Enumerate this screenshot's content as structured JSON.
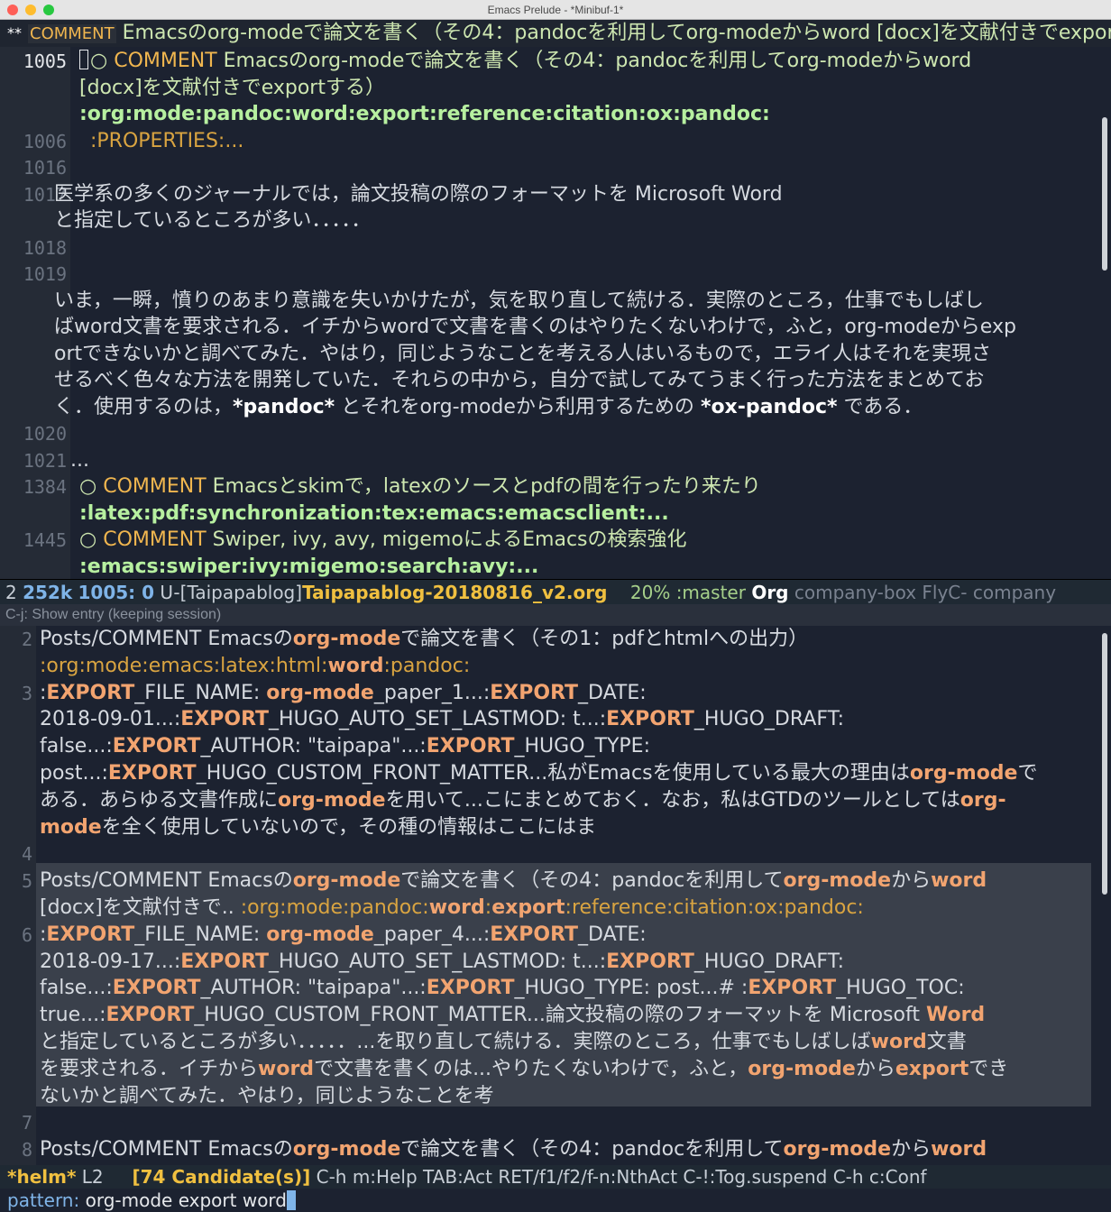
{
  "window": {
    "title": "Emacs Prelude -  *Minibuf-1*"
  },
  "header_line": {
    "stars": "**",
    "keyword": "COMMENT",
    "text": "Emacsのorg-modeで論文を書く（その4：pandocを利用してorg-modeからword [docx]を文献付きでexportする）"
  },
  "editor": {
    "lines": [
      {
        "num": "1005",
        "prefix": "○ ",
        "keyword": "COMMENT",
        "text": " Emacsのorg-modeで論文を書く（その4：pandocを利用してorg-modeからword"
      },
      {
        "num": "",
        "text": "[docx]を文献付きでexportする）"
      },
      {
        "num": "",
        "tags": ":org:mode:pandoc:word:export:reference:citation:ox:pandoc:"
      },
      {
        "num": "1006",
        "props": ":PROPERTIES:..."
      },
      {
        "num": "1016",
        "text": ""
      },
      {
        "num": "1017",
        "text": "  医学系の多くのジャーナルでは，論文投稿の際のフォーマットを Microsoft Word"
      },
      {
        "num": "",
        "text": "と指定しているところが多い．．．．．"
      },
      {
        "num": "1018",
        "text": ""
      },
      {
        "num": "1019",
        "text": ""
      },
      {
        "num": "",
        "text": "いま，一瞬，憤りのあまり意識を失いかけたが，気を取り直して続ける．実際のところ，仕事でもしばし"
      },
      {
        "num": "",
        "text": "ばword文書を要求される．イチからwordで文書を書くのはやりたくないわけで，ふと，org-modeからexp"
      },
      {
        "num": "",
        "text": "ortできないかと調べてみた．やはり，同じようなことを考える人はいるもので，エライ人はそれを実現さ"
      },
      {
        "num": "",
        "text": "せるべく色々な方法を開発していた．それらの中から，自分で試してみてうまく行った方法をまとめてお"
      },
      {
        "num": "",
        "text_a": "く．使用するのは，",
        "bold_a": "*pandoc*",
        "text_b": " とそれをorg-modeから利用するための ",
        "bold_b": "*ox-pandoc*",
        "text_c": " である．"
      },
      {
        "num": "1020",
        "text": ""
      },
      {
        "num": "1021",
        "text": "..."
      },
      {
        "num": "1384",
        "prefix": "○ ",
        "keyword": "COMMENT",
        "text": " Emacsとskimで，latexのソースとpdfの間を行ったり来たり"
      },
      {
        "num": "",
        "tags": ":latex:pdf:synchronization:tex:emacs:emacsclient:..."
      },
      {
        "num": "1445",
        "prefix": "○ ",
        "keyword": "COMMENT",
        "text": " Swiper, ivy, avy, migemoによるEmacsの検索強化"
      },
      {
        "num": "",
        "tags": ":emacs:swiper:ivy:migemo:search:avy:..."
      }
    ]
  },
  "modeline": {
    "window_num": "2",
    "size": "252k",
    "position": "1005: 0",
    "encoding": "U",
    "buffer_prefix": "-[Taipapablog]",
    "buffer_name": "Taipapablog-20180816_v2.org",
    "percent": "20%",
    "branch": ":master",
    "major_mode": "Org",
    "minor_modes": "company-box FlyC- company"
  },
  "helm": {
    "header": "C-j: Show entry (keeping session)",
    "candidates_text": [
      {
        "num": "2",
        "segs": [
          [
            "Posts/COMMENT Emacsの",
            ""
          ],
          [
            "org-mode",
            "m"
          ],
          [
            "で論文を書く（その1：pdfとhtmlへの出力）",
            ""
          ]
        ]
      },
      {
        "num": "",
        "segs": [
          [
            ":org:mode:emacs:latex:html:",
            "mtag"
          ],
          [
            "word",
            "m"
          ],
          [
            ":pandoc:",
            "mtag"
          ]
        ]
      },
      {
        "num": "3",
        "segs": [
          [
            ":",
            ""
          ],
          [
            "EXPORT",
            "m"
          ],
          [
            "_FILE_NAME: ",
            ""
          ],
          [
            "org-mode",
            "m"
          ],
          [
            "_paper_1...:",
            ""
          ],
          [
            "EXPORT",
            "m"
          ],
          [
            "_DATE:",
            ""
          ]
        ]
      },
      {
        "num": "",
        "segs": [
          [
            "2018-09-01...:",
            ""
          ],
          [
            "EXPORT",
            "m"
          ],
          [
            "_HUGO_AUTO_SET_LASTMOD: t...:",
            ""
          ],
          [
            "EXPORT",
            "m"
          ],
          [
            "_HUGO_DRAFT:",
            ""
          ]
        ]
      },
      {
        "num": "",
        "segs": [
          [
            "false...:",
            ""
          ],
          [
            "EXPORT",
            "m"
          ],
          [
            "_AUTHOR: \"taipapa\"...:",
            ""
          ],
          [
            "EXPORT",
            "m"
          ],
          [
            "_HUGO_TYPE:",
            ""
          ]
        ]
      },
      {
        "num": "",
        "segs": [
          [
            "post...:",
            ""
          ],
          [
            "EXPORT",
            "m"
          ],
          [
            "_HUGO_CUSTOM_FRONT_MATTER...私がEmacsを使用している最大の理由は",
            ""
          ],
          [
            "org-mode",
            "m"
          ],
          [
            "で",
            ""
          ]
        ]
      },
      {
        "num": "",
        "segs": [
          [
            "ある．あらゆる文書作成に",
            ""
          ],
          [
            "org-mode",
            "m"
          ],
          [
            "を用いて...こにまとめておく．なお，私はGTDのツールとしては",
            ""
          ],
          [
            "org-",
            "m"
          ]
        ]
      },
      {
        "num": "",
        "segs": [
          [
            "mode",
            "m"
          ],
          [
            "を全く使用していないので，その種の情報はここにはま",
            ""
          ]
        ]
      },
      {
        "num": "4",
        "segs": [
          [
            "",
            ""
          ]
        ]
      },
      {
        "num": "5",
        "segs": [
          [
            "Posts/COMMENT Emacsの",
            ""
          ],
          [
            "org-mode",
            "m"
          ],
          [
            "で論文を書く（その4：pandocを利用して",
            ""
          ],
          [
            "org-mode",
            "m"
          ],
          [
            "から",
            ""
          ],
          [
            "word",
            "m"
          ]
        ]
      },
      {
        "num": "",
        "segs": [
          [
            "[docx]を文献付きで.. ",
            ""
          ],
          [
            ":org:mode:pandoc:",
            "mtag"
          ],
          [
            "word",
            "m"
          ],
          [
            ":",
            "mtag"
          ],
          [
            "export",
            "m"
          ],
          [
            ":reference:citation:ox:pandoc:",
            "mtag"
          ]
        ]
      },
      {
        "num": "6",
        "segs": [
          [
            ":",
            ""
          ],
          [
            "EXPORT",
            "m"
          ],
          [
            "_FILE_NAME: ",
            ""
          ],
          [
            "org-mode",
            "m"
          ],
          [
            "_paper_4...:",
            ""
          ],
          [
            "EXPORT",
            "m"
          ],
          [
            "_DATE:",
            ""
          ]
        ]
      },
      {
        "num": "",
        "segs": [
          [
            "2018-09-17...:",
            ""
          ],
          [
            "EXPORT",
            "m"
          ],
          [
            "_HUGO_AUTO_SET_LASTMOD: t...:",
            ""
          ],
          [
            "EXPORT",
            "m"
          ],
          [
            "_HUGO_DRAFT:",
            ""
          ]
        ]
      },
      {
        "num": "",
        "segs": [
          [
            "false...:",
            ""
          ],
          [
            "EXPORT",
            "m"
          ],
          [
            "_AUTHOR: \"taipapa\"...:",
            ""
          ],
          [
            "EXPORT",
            "m"
          ],
          [
            "_HUGO_TYPE: post...# :",
            ""
          ],
          [
            "EXPORT",
            "m"
          ],
          [
            "_HUGO_TOC:",
            ""
          ]
        ]
      },
      {
        "num": "",
        "segs": [
          [
            "true...:",
            ""
          ],
          [
            "EXPORT",
            "m"
          ],
          [
            "_HUGO_CUSTOM_FRONT_MATTER...論文投稿の際のフォーマットを Microsoft ",
            ""
          ],
          [
            "Word",
            "m"
          ]
        ]
      },
      {
        "num": "",
        "segs": [
          [
            "と指定しているところが多い．．．．．...を取り直して続ける．実際のところ，仕事でもしばしば",
            ""
          ],
          [
            "word",
            "m"
          ],
          [
            "文書",
            ""
          ]
        ]
      },
      {
        "num": "",
        "segs": [
          [
            "を要求される．イチから",
            ""
          ],
          [
            "word",
            "m"
          ],
          [
            "で文書を書くのは...やりたくないわけで，ふと，",
            ""
          ],
          [
            "org-mode",
            "m"
          ],
          [
            "から",
            ""
          ],
          [
            "export",
            "m"
          ],
          [
            "でき",
            ""
          ]
        ]
      },
      {
        "num": "",
        "segs": [
          [
            "ないかと調べてみた．やはり，同じようなことを考",
            ""
          ]
        ]
      },
      {
        "num": "7",
        "segs": [
          [
            "",
            ""
          ]
        ]
      },
      {
        "num": "8",
        "segs": [
          [
            "Posts/COMMENT Emacsの",
            ""
          ],
          [
            "org-mode",
            "m"
          ],
          [
            "で論文を書く（その4：pandocを利用して",
            ""
          ],
          [
            "org-mode",
            "m"
          ],
          [
            "から",
            ""
          ],
          [
            "word",
            "m"
          ]
        ]
      }
    ]
  },
  "helm_modeline": {
    "name": "*helm*",
    "line": "L2",
    "candidates": "[74 Candidate(s)]",
    "help": "C-h m:Help TAB:Act RET/f1/f2/f-n:NthAct C-!:Tog.suspend C-h c:Conf"
  },
  "minibuffer": {
    "label": "pattern:",
    "value": " org-mode export word"
  }
}
